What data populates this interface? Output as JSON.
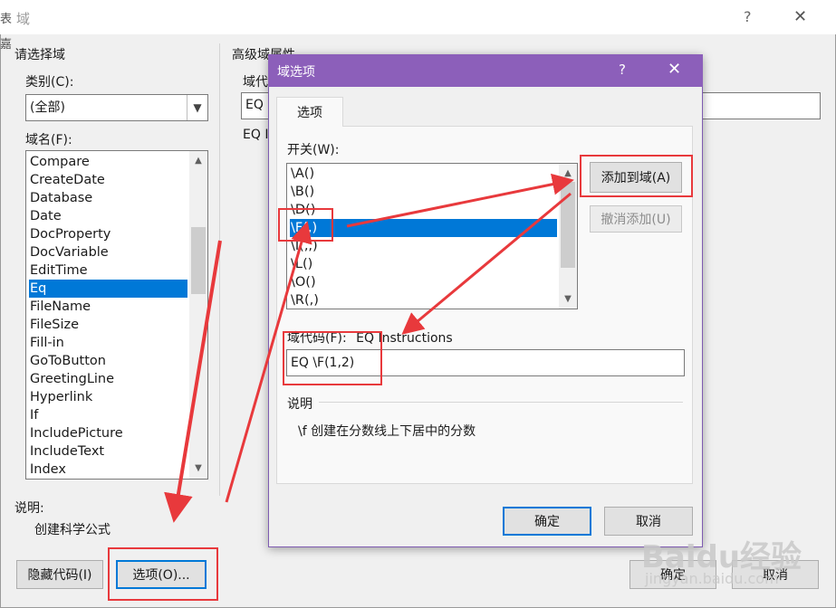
{
  "outer_dialog": {
    "title": "域",
    "help": "?",
    "close": "✕",
    "select_field_heading": "请选择域",
    "category_label": "类别(C):",
    "category_value": "(全部)",
    "field_names_label": "域名(F):",
    "field_names": [
      "Compare",
      "CreateDate",
      "Database",
      "Date",
      "DocProperty",
      "DocVariable",
      "EditTime",
      "Eq",
      "FileName",
      "FileSize",
      "Fill-in",
      "GoToButton",
      "GreetingLine",
      "Hyperlink",
      "If",
      "IncludePicture",
      "IncludeText",
      "Index"
    ],
    "selected_field": "Eq",
    "advanced_heading": "高级域属性",
    "field_codes_label": "域代",
    "field_code_value": "EQ",
    "eq_hint": "EQ I",
    "description_label": "说明:",
    "description_text": "创建科学公式",
    "hide_codes_button": "隐藏代码(I)",
    "options_button": "选项(O)...",
    "ok_button": "确定",
    "cancel_button": "取消",
    "edge_fragments": [
      "表",
      "嘉"
    ]
  },
  "inner_dialog": {
    "title": "域选项",
    "help": "?",
    "close": "✕",
    "tab_label": "选项",
    "switches_label": "开关(W):",
    "switches": [
      "\\A()",
      "\\B()",
      "\\D()",
      "\\F(,)",
      "\\I(,,)",
      "\\L()",
      "\\O()",
      "\\R(,)"
    ],
    "selected_switch": "\\F(,)",
    "add_button": "添加到域(A)",
    "undo_button": "撤消添加(U)",
    "field_codes_label": "域代码(F):",
    "field_codes_hint": "EQ Instructions",
    "field_code_value": "EQ \\F(1,2)",
    "description_label": "说明",
    "description_text": "\\f 创建在分数线上下居中的分数",
    "ok_button": "确定",
    "cancel_button": "取消"
  },
  "watermark": {
    "brand": "Baidu经验",
    "url": "jingyan.baidu.com"
  },
  "colors": {
    "selection": "#0078d7",
    "inner_title_bar": "#8c5fba",
    "annotation": "#e8393c"
  }
}
